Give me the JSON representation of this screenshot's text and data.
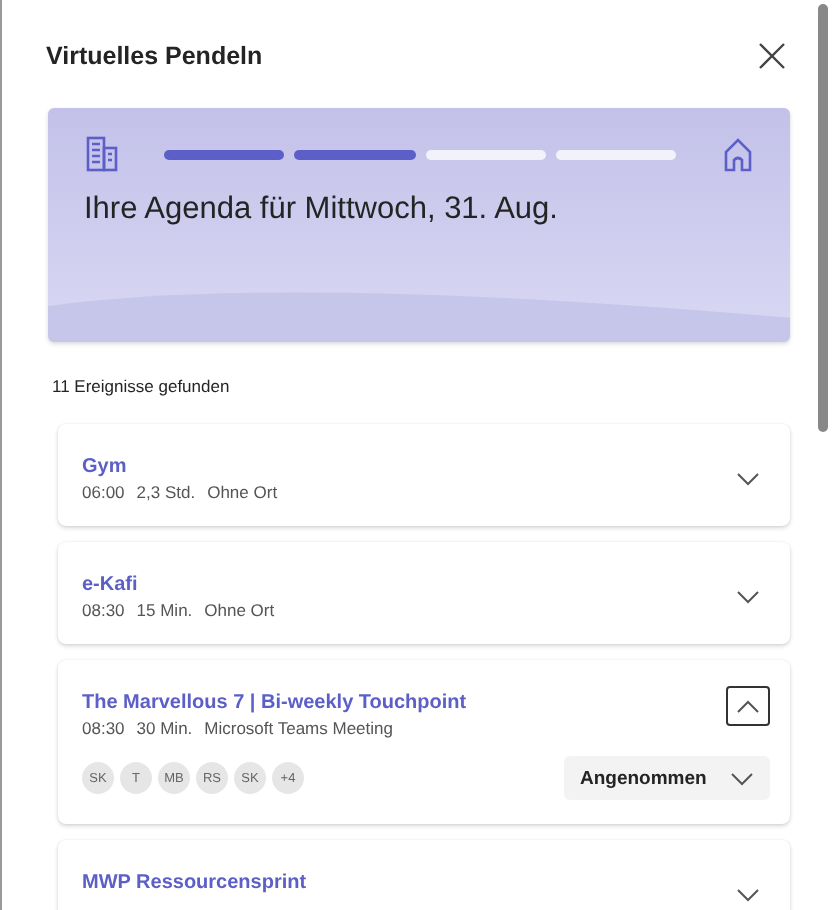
{
  "dialog": {
    "title": "Virtuelles Pendeln"
  },
  "banner": {
    "steps": [
      {
        "done": true
      },
      {
        "done": true
      },
      {
        "done": false
      },
      {
        "done": false
      }
    ],
    "heading": "Ihre Agenda für Mittwoch, 31. Aug."
  },
  "result_count": "11 Ereignisse gefunden",
  "events": [
    {
      "title": "Gym",
      "time": "06:00",
      "duration": "2,3 Std.",
      "location": "Ohne Ort",
      "expanded": false
    },
    {
      "title": "e-Kafi",
      "time": "08:30",
      "duration": "15 Min.",
      "location": "Ohne Ort",
      "expanded": false
    },
    {
      "title": "The Marvellous 7 | Bi-weekly Touchpoint",
      "time": "08:30",
      "duration": "30 Min.",
      "location": "Microsoft Teams Meeting",
      "expanded": true,
      "attendees": [
        "SK",
        "T",
        "MB",
        "RS",
        "SK",
        "+4"
      ],
      "response": "Angenommen"
    },
    {
      "title": "MWP Ressourcensprint",
      "expanded": false
    }
  ]
}
